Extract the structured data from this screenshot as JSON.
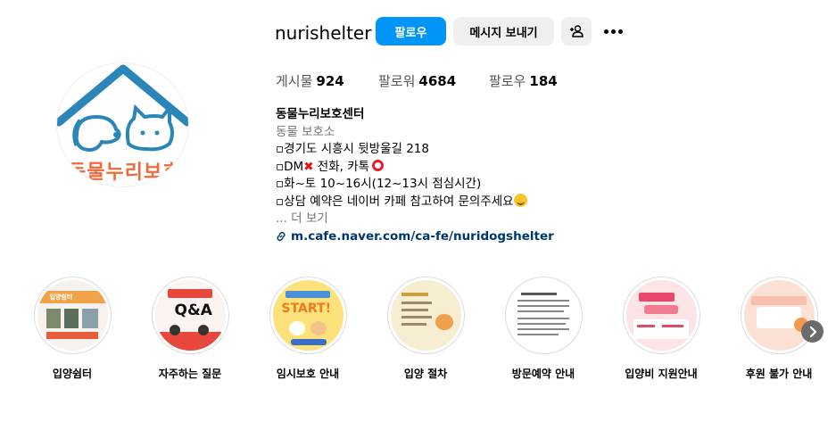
{
  "profile": {
    "username": "nurishelter",
    "avatar_text": "동물누리보호",
    "follow_label": "팔로우",
    "message_label": "메시지 보내기"
  },
  "stats": {
    "posts_label": "게시물",
    "posts_count": "924",
    "followers_label": "팔로워",
    "followers_count": "4684",
    "following_label": "팔로우",
    "following_count": "184"
  },
  "bio": {
    "name": "동물누리보호센터",
    "category": "동물 보호소",
    "line1": "▫경기도 시흥시 뒷방울길 218",
    "line2_pre": "▫DM",
    "line2_post": " 전화, 카톡",
    "line3": "▫화~토 10~16시(12~13시 점심시간)",
    "line4": "▫상담 예약은 네이버 카페 참고하여 문의주세요",
    "more": "... 더 보기",
    "link": "m.cafe.naver.com/ca-fe/nuridogshelter"
  },
  "highlights": [
    {
      "label": "입양쉼터",
      "mini": "입양쉼터"
    },
    {
      "label": "자주하는 질문",
      "mini": "Q&A"
    },
    {
      "label": "임시보호 안내",
      "mini": "START!"
    },
    {
      "label": "입양 절차",
      "mini": ""
    },
    {
      "label": "방문예약 안내",
      "mini": ""
    },
    {
      "label": "입양비 지원안내",
      "mini": ""
    },
    {
      "label": "후원 불가 안내",
      "mini": ""
    }
  ],
  "colors": {
    "accent": "#0095f6",
    "avatar_roof": "#2a86b8",
    "avatar_text": "#ef6a3a",
    "link": "#00376b"
  },
  "icons": {
    "add_user": "add-user-icon",
    "more": "more-icon",
    "link": "link-icon",
    "next": "chevron-right-icon"
  }
}
